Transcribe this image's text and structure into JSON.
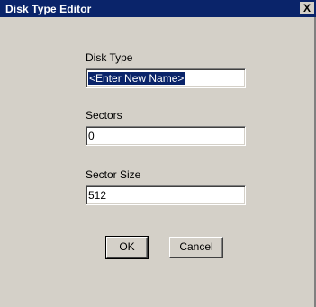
{
  "window": {
    "title": "Disk Type Editor",
    "close_label": "X"
  },
  "form": {
    "disk_type_label": "Disk Type",
    "disk_type_value": "<Enter New Name>",
    "sectors_label": "Sectors",
    "sectors_value": "0",
    "sector_size_label": "Sector Size",
    "sector_size_value": "512"
  },
  "buttons": {
    "ok_label": "OK",
    "cancel_label": "Cancel"
  }
}
